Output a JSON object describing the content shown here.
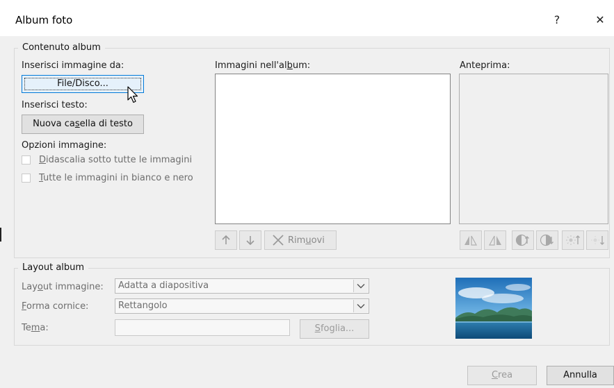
{
  "dialog": {
    "title": "Album foto",
    "help_label": "?",
    "close_label": "✕"
  },
  "contenuto": {
    "group_label": "Contenuto album",
    "insert_image_label": "Inserisci immagine da:",
    "file_button": "File/Disco...",
    "insert_text_label": "Inserisci testo:",
    "new_textbox_prefix": "Nuova ca",
    "new_textbox_underlined": "s",
    "new_textbox_suffix": "ella di testo",
    "image_options_label": "Opzioni immagine:",
    "caption_u": "D",
    "caption_rest": "idascalia sotto tutte le immagini",
    "bw_u": "T",
    "bw_rest": "utte le immagini in bianco e nero",
    "album_images_prefix": "Immagini nell'al",
    "album_images_underlined": "b",
    "album_images_suffix": "um:",
    "preview_label": "Anteprima:",
    "remove_prefix": "Rim",
    "remove_underlined": "u",
    "remove_suffix": "ovi"
  },
  "layout": {
    "group_label": "Layout album",
    "image_layout_prefix": "Lay",
    "image_layout_underlined": "o",
    "image_layout_suffix": "ut immagine:",
    "image_layout_value": "Adatta a diapositiva",
    "frame_shape_underlined": "F",
    "frame_shape_suffix": "orma cornice:",
    "frame_shape_value": "Rettangolo",
    "theme_prefix": "Te",
    "theme_underlined": "m",
    "theme_suffix": "a:",
    "browse_underlined": "S",
    "browse_suffix": "foglia..."
  },
  "footer": {
    "create_underlined": "C",
    "create_suffix": "rea",
    "cancel_label": "Annulla"
  },
  "icons": [
    "help-icon",
    "close-icon",
    "mouse-cursor-icon",
    "arrow-up-icon",
    "arrow-down-icon",
    "remove-x-icon",
    "rotate-left-icon",
    "rotate-right-icon",
    "contrast-increase-icon",
    "contrast-decrease-icon",
    "brightness-increase-icon",
    "brightness-decrease-icon",
    "chevron-down-icon",
    "landscape-thumbnail"
  ]
}
